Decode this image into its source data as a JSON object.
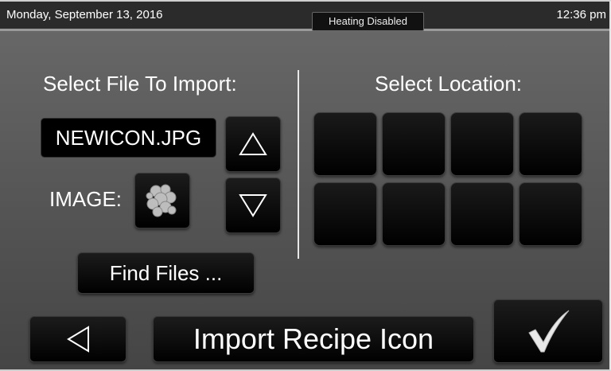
{
  "status": {
    "date": "Monday, September 13, 2016",
    "heating": "Heating Disabled",
    "time": "12:36 pm"
  },
  "left_panel": {
    "heading": "Select File To Import:",
    "filename": "NEWICON.JPG",
    "image_label": "IMAGE:",
    "find_label": "Find Files ..."
  },
  "right_panel": {
    "heading": "Select Location:"
  },
  "footer": {
    "title": "Import Recipe Icon"
  },
  "icons": {
    "up": "triangle-up-icon",
    "down": "triangle-down-icon",
    "back": "triangle-left-icon",
    "confirm": "checkmark-icon"
  },
  "colors": {
    "background": "#555555",
    "button": "#000000",
    "text": "#ffffff"
  }
}
